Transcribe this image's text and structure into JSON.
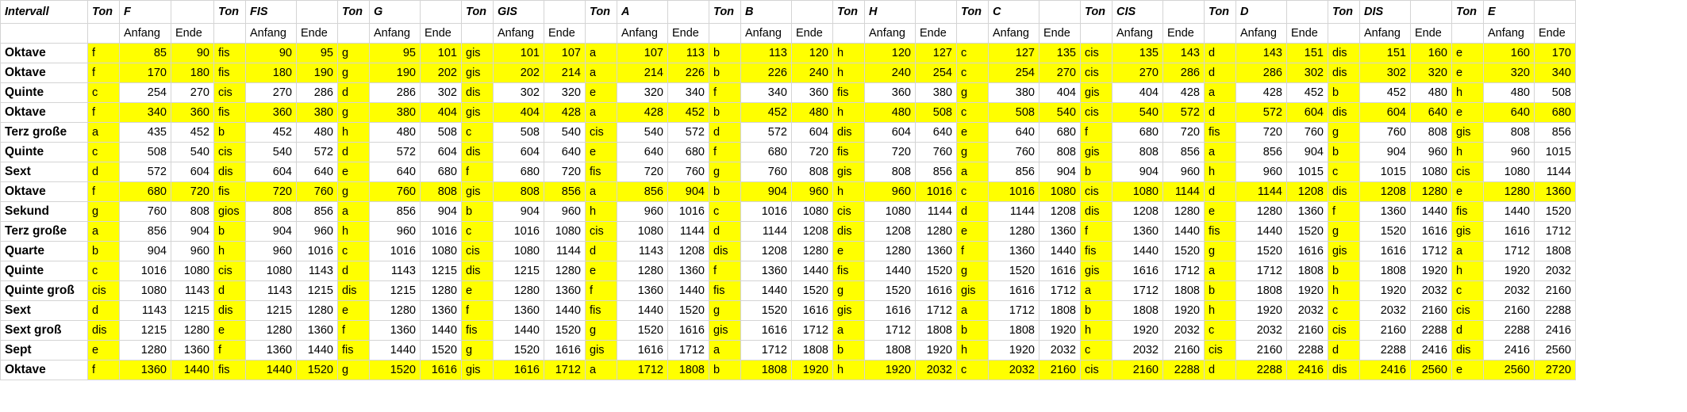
{
  "highlight_color": "#ffff00",
  "header": {
    "intervall": "Intervall",
    "groups": [
      {
        "ton": "Ton",
        "name": "F"
      },
      {
        "ton": "Ton",
        "name": "FIS"
      },
      {
        "ton": "Ton",
        "name": "G"
      },
      {
        "ton": "Ton",
        "name": "GIS"
      },
      {
        "ton": "Ton",
        "name": "A"
      },
      {
        "ton": "Ton",
        "name": "B"
      },
      {
        "ton": "Ton",
        "name": "H"
      },
      {
        "ton": "Ton",
        "name": "C"
      },
      {
        "ton": "Ton",
        "name": "CIS"
      },
      {
        "ton": "Ton",
        "name": "D"
      },
      {
        "ton": "Ton",
        "name": "DIS"
      },
      {
        "ton": "Ton",
        "name": "E"
      }
    ],
    "anfang": "Anfang",
    "ende": "Ende"
  },
  "rows": [
    {
      "interval": "Oktave",
      "yellow": true,
      "cells": [
        [
          "f",
          "85",
          "90"
        ],
        [
          "fis",
          "90",
          "95"
        ],
        [
          "g",
          "95",
          "101"
        ],
        [
          "gis",
          "101",
          "107"
        ],
        [
          "a",
          "107",
          "113"
        ],
        [
          "b",
          "113",
          "120"
        ],
        [
          "h",
          "120",
          "127"
        ],
        [
          "c",
          "127",
          "135"
        ],
        [
          "cis",
          "135",
          "143"
        ],
        [
          "d",
          "143",
          "151"
        ],
        [
          "dis",
          "151",
          "160"
        ],
        [
          "e",
          "160",
          "170"
        ]
      ]
    },
    {
      "interval": "Oktave",
      "yellow": true,
      "cells": [
        [
          "f",
          "170",
          "180"
        ],
        [
          "fis",
          "180",
          "190"
        ],
        [
          "g",
          "190",
          "202"
        ],
        [
          "gis",
          "202",
          "214"
        ],
        [
          "a",
          "214",
          "226"
        ],
        [
          "b",
          "226",
          "240"
        ],
        [
          "h",
          "240",
          "254"
        ],
        [
          "c",
          "254",
          "270"
        ],
        [
          "cis",
          "270",
          "286"
        ],
        [
          "d",
          "286",
          "302"
        ],
        [
          "dis",
          "302",
          "320"
        ],
        [
          "e",
          "320",
          "340"
        ]
      ]
    },
    {
      "interval": "Quinte",
      "yellow": false,
      "cells": [
        [
          "c",
          "254",
          "270"
        ],
        [
          "cis",
          "270",
          "286"
        ],
        [
          "d",
          "286",
          "302"
        ],
        [
          "dis",
          "302",
          "320"
        ],
        [
          "e",
          "320",
          "340"
        ],
        [
          "f",
          "340",
          "360"
        ],
        [
          "fis",
          "360",
          "380"
        ],
        [
          "g",
          "380",
          "404"
        ],
        [
          "gis",
          "404",
          "428"
        ],
        [
          "a",
          "428",
          "452"
        ],
        [
          "b",
          "452",
          "480"
        ],
        [
          "h",
          "480",
          "508"
        ]
      ]
    },
    {
      "interval": "Oktave",
      "yellow": true,
      "cells": [
        [
          "f",
          "340",
          "360"
        ],
        [
          "fis",
          "360",
          "380"
        ],
        [
          "g",
          "380",
          "404"
        ],
        [
          "gis",
          "404",
          "428"
        ],
        [
          "a",
          "428",
          "452"
        ],
        [
          "b",
          "452",
          "480"
        ],
        [
          "h",
          "480",
          "508"
        ],
        [
          "c",
          "508",
          "540"
        ],
        [
          "cis",
          "540",
          "572"
        ],
        [
          "d",
          "572",
          "604"
        ],
        [
          "dis",
          "604",
          "640"
        ],
        [
          "e",
          "640",
          "680"
        ]
      ]
    },
    {
      "interval": "Terz große",
      "yellow": false,
      "cells": [
        [
          "a",
          "435",
          "452"
        ],
        [
          "b",
          "452",
          "480"
        ],
        [
          "h",
          "480",
          "508"
        ],
        [
          "c",
          "508",
          "540"
        ],
        [
          "cis",
          "540",
          "572"
        ],
        [
          "d",
          "572",
          "604"
        ],
        [
          "dis",
          "604",
          "640"
        ],
        [
          "e",
          "640",
          "680"
        ],
        [
          "f",
          "680",
          "720"
        ],
        [
          "fis",
          "720",
          "760"
        ],
        [
          "g",
          "760",
          "808"
        ],
        [
          "gis",
          "808",
          "856"
        ]
      ]
    },
    {
      "interval": "Quinte",
      "yellow": false,
      "cells": [
        [
          "c",
          "508",
          "540"
        ],
        [
          "cis",
          "540",
          "572"
        ],
        [
          "d",
          "572",
          "604"
        ],
        [
          "dis",
          "604",
          "640"
        ],
        [
          "e",
          "640",
          "680"
        ],
        [
          "f",
          "680",
          "720"
        ],
        [
          "fis",
          "720",
          "760"
        ],
        [
          "g",
          "760",
          "808"
        ],
        [
          "gis",
          "808",
          "856"
        ],
        [
          "a",
          "856",
          "904"
        ],
        [
          "b",
          "904",
          "960"
        ],
        [
          "h",
          "960",
          "1015"
        ]
      ]
    },
    {
      "interval": "Sext",
      "yellow": false,
      "cells": [
        [
          "d",
          "572",
          "604"
        ],
        [
          "dis",
          "604",
          "640"
        ],
        [
          "e",
          "640",
          "680"
        ],
        [
          "f",
          "680",
          "720"
        ],
        [
          "fis",
          "720",
          "760"
        ],
        [
          "g",
          "760",
          "808"
        ],
        [
          "gis",
          "808",
          "856"
        ],
        [
          "a",
          "856",
          "904"
        ],
        [
          "b",
          "904",
          "960"
        ],
        [
          "h",
          "960",
          "1015"
        ],
        [
          "c",
          "1015",
          "1080"
        ],
        [
          "cis",
          "1080",
          "1144"
        ]
      ]
    },
    {
      "interval": "Oktave",
      "yellow": true,
      "cells": [
        [
          "f",
          "680",
          "720"
        ],
        [
          "fis",
          "720",
          "760"
        ],
        [
          "g",
          "760",
          "808"
        ],
        [
          "gis",
          "808",
          "856"
        ],
        [
          "a",
          "856",
          "904"
        ],
        [
          "b",
          "904",
          "960"
        ],
        [
          "h",
          "960",
          "1016"
        ],
        [
          "c",
          "1016",
          "1080"
        ],
        [
          "cis",
          "1080",
          "1144"
        ],
        [
          "d",
          "1144",
          "1208"
        ],
        [
          "dis",
          "1208",
          "1280"
        ],
        [
          "e",
          "1280",
          "1360"
        ]
      ]
    },
    {
      "interval": "Sekund",
      "yellow": false,
      "cells": [
        [
          "g",
          "760",
          "808"
        ],
        [
          "gios",
          "808",
          "856"
        ],
        [
          "a",
          "856",
          "904"
        ],
        [
          "b",
          "904",
          "960"
        ],
        [
          "h",
          "960",
          "1016"
        ],
        [
          "c",
          "1016",
          "1080"
        ],
        [
          "cis",
          "1080",
          "1144"
        ],
        [
          "d",
          "1144",
          "1208"
        ],
        [
          "dis",
          "1208",
          "1280"
        ],
        [
          "e",
          "1280",
          "1360"
        ],
        [
          "f",
          "1360",
          "1440"
        ],
        [
          "fis",
          "1440",
          "1520"
        ]
      ]
    },
    {
      "interval": "Terz große",
      "yellow": false,
      "cells": [
        [
          "a",
          "856",
          "904"
        ],
        [
          "b",
          "904",
          "960"
        ],
        [
          "h",
          "960",
          "1016"
        ],
        [
          "c",
          "1016",
          "1080"
        ],
        [
          "cis",
          "1080",
          "1144"
        ],
        [
          "d",
          "1144",
          "1208"
        ],
        [
          "dis",
          "1208",
          "1280"
        ],
        [
          "e",
          "1280",
          "1360"
        ],
        [
          "f",
          "1360",
          "1440"
        ],
        [
          "fis",
          "1440",
          "1520"
        ],
        [
          "g",
          "1520",
          "1616"
        ],
        [
          "gis",
          "1616",
          "1712"
        ]
      ]
    },
    {
      "interval": "Quarte",
      "yellow": false,
      "cells": [
        [
          "b",
          "904",
          "960"
        ],
        [
          "h",
          "960",
          "1016"
        ],
        [
          "c",
          "1016",
          "1080"
        ],
        [
          "cis",
          "1080",
          "1144"
        ],
        [
          "d",
          "1143",
          "1208"
        ],
        [
          "dis",
          "1208",
          "1280"
        ],
        [
          "e",
          "1280",
          "1360"
        ],
        [
          "f",
          "1360",
          "1440"
        ],
        [
          "fis",
          "1440",
          "1520"
        ],
        [
          "g",
          "1520",
          "1616"
        ],
        [
          "gis",
          "1616",
          "1712"
        ],
        [
          "a",
          "1712",
          "1808"
        ]
      ]
    },
    {
      "interval": "Quinte",
      "yellow": false,
      "cells": [
        [
          "c",
          "1016",
          "1080"
        ],
        [
          "cis",
          "1080",
          "1143"
        ],
        [
          "d",
          "1143",
          "1215"
        ],
        [
          "dis",
          "1215",
          "1280"
        ],
        [
          "e",
          "1280",
          "1360"
        ],
        [
          "f",
          "1360",
          "1440"
        ],
        [
          "fis",
          "1440",
          "1520"
        ],
        [
          "g",
          "1520",
          "1616"
        ],
        [
          "gis",
          "1616",
          "1712"
        ],
        [
          "a",
          "1712",
          "1808"
        ],
        [
          "b",
          "1808",
          "1920"
        ],
        [
          "h",
          "1920",
          "2032"
        ]
      ]
    },
    {
      "interval": "Quinte groß",
      "yellow": false,
      "cells": [
        [
          "cis",
          "1080",
          "1143"
        ],
        [
          "d",
          "1143",
          "1215"
        ],
        [
          "dis",
          "1215",
          "1280"
        ],
        [
          "e",
          "1280",
          "1360"
        ],
        [
          "f",
          "1360",
          "1440"
        ],
        [
          "fis",
          "1440",
          "1520"
        ],
        [
          "g",
          "1520",
          "1616"
        ],
        [
          "gis",
          "1616",
          "1712"
        ],
        [
          "a",
          "1712",
          "1808"
        ],
        [
          "b",
          "1808",
          "1920"
        ],
        [
          "h",
          "1920",
          "2032"
        ],
        [
          "c",
          "2032",
          "2160"
        ]
      ]
    },
    {
      "interval": "Sext",
      "yellow": false,
      "cells": [
        [
          "d",
          "1143",
          "1215"
        ],
        [
          "dis",
          "1215",
          "1280"
        ],
        [
          "e",
          "1280",
          "1360"
        ],
        [
          "f",
          "1360",
          "1440"
        ],
        [
          "fis",
          "1440",
          "1520"
        ],
        [
          "g",
          "1520",
          "1616"
        ],
        [
          "gis",
          "1616",
          "1712"
        ],
        [
          "a",
          "1712",
          "1808"
        ],
        [
          "b",
          "1808",
          "1920"
        ],
        [
          "h",
          "1920",
          "2032"
        ],
        [
          "c",
          "2032",
          "2160"
        ],
        [
          "cis",
          "2160",
          "2288"
        ]
      ]
    },
    {
      "interval": "Sext groß",
      "yellow": false,
      "cells": [
        [
          "dis",
          "1215",
          "1280"
        ],
        [
          "e",
          "1280",
          "1360"
        ],
        [
          "f",
          "1360",
          "1440"
        ],
        [
          "fis",
          "1440",
          "1520"
        ],
        [
          "g",
          "1520",
          "1616"
        ],
        [
          "gis",
          "1616",
          "1712"
        ],
        [
          "a",
          "1712",
          "1808"
        ],
        [
          "b",
          "1808",
          "1920"
        ],
        [
          "h",
          "1920",
          "2032"
        ],
        [
          "c",
          "2032",
          "2160"
        ],
        [
          "cis",
          "2160",
          "2288"
        ],
        [
          "d",
          "2288",
          "2416"
        ]
      ]
    },
    {
      "interval": "Sept",
      "yellow": false,
      "cells": [
        [
          "e",
          "1280",
          "1360"
        ],
        [
          "f",
          "1360",
          "1440"
        ],
        [
          "fis",
          "1440",
          "1520"
        ],
        [
          "g",
          "1520",
          "1616"
        ],
        [
          "gis",
          "1616",
          "1712"
        ],
        [
          "a",
          "1712",
          "1808"
        ],
        [
          "b",
          "1808",
          "1920"
        ],
        [
          "h",
          "1920",
          "2032"
        ],
        [
          "c",
          "2032",
          "2160"
        ],
        [
          "cis",
          "2160",
          "2288"
        ],
        [
          "d",
          "2288",
          "2416"
        ],
        [
          "dis",
          "2416",
          "2560"
        ]
      ]
    },
    {
      "interval": "Oktave",
      "yellow": true,
      "cells": [
        [
          "f",
          "1360",
          "1440"
        ],
        [
          "fis",
          "1440",
          "1520"
        ],
        [
          "g",
          "1520",
          "1616"
        ],
        [
          "gis",
          "1616",
          "1712"
        ],
        [
          "a",
          "1712",
          "1808"
        ],
        [
          "b",
          "1808",
          "1920"
        ],
        [
          "h",
          "1920",
          "2032"
        ],
        [
          "c",
          "2032",
          "2160"
        ],
        [
          "cis",
          "2160",
          "2288"
        ],
        [
          "d",
          "2288",
          "2416"
        ],
        [
          "dis",
          "2416",
          "2560"
        ],
        [
          "e",
          "2560",
          "2720"
        ]
      ]
    }
  ]
}
